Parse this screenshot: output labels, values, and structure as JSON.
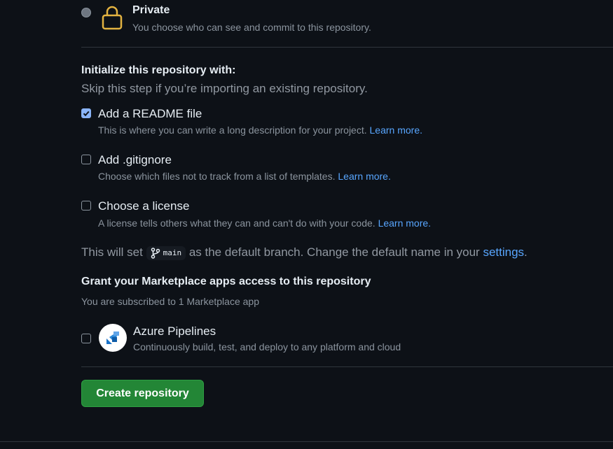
{
  "visibility": {
    "private_label": "Private",
    "private_desc": "You choose who can see and commit to this repository."
  },
  "init": {
    "heading": "Initialize this repository with:",
    "subheading": "Skip this step if you’re importing an existing repository.",
    "options": [
      {
        "label": "Add a README file",
        "desc": "This is where you can write a long description for your project.",
        "link": "Learn more.",
        "checked": true
      },
      {
        "label": "Add .gitignore",
        "desc": "Choose which files not to track from a list of templates.",
        "link": "Learn more.",
        "checked": false
      },
      {
        "label": "Choose a license",
        "desc": "A license tells others what they can and can't do with your code.",
        "link": "Learn more.",
        "checked": false
      }
    ]
  },
  "branch": {
    "prefix": "This will set",
    "name": "main",
    "middle": "as the default branch. Change the default name in your",
    "settings_link": "settings",
    "suffix": "."
  },
  "marketplace": {
    "heading": "Grant your Marketplace apps access to this repository",
    "subheading": "You are subscribed to 1 Marketplace app",
    "app_name": "Azure Pipelines",
    "app_desc": "Continuously build, test, and deploy to any platform and cloud",
    "app_checked": false
  },
  "actions": {
    "create_label": "Create repository"
  },
  "colors": {
    "background": "#0d1117",
    "primary_button": "#238636",
    "link": "#58a6ff",
    "lock": "#e3b341"
  },
  "icons": [
    "lock-icon",
    "git-branch-icon",
    "azure-pipelines-icon",
    "checkmark-icon"
  ]
}
